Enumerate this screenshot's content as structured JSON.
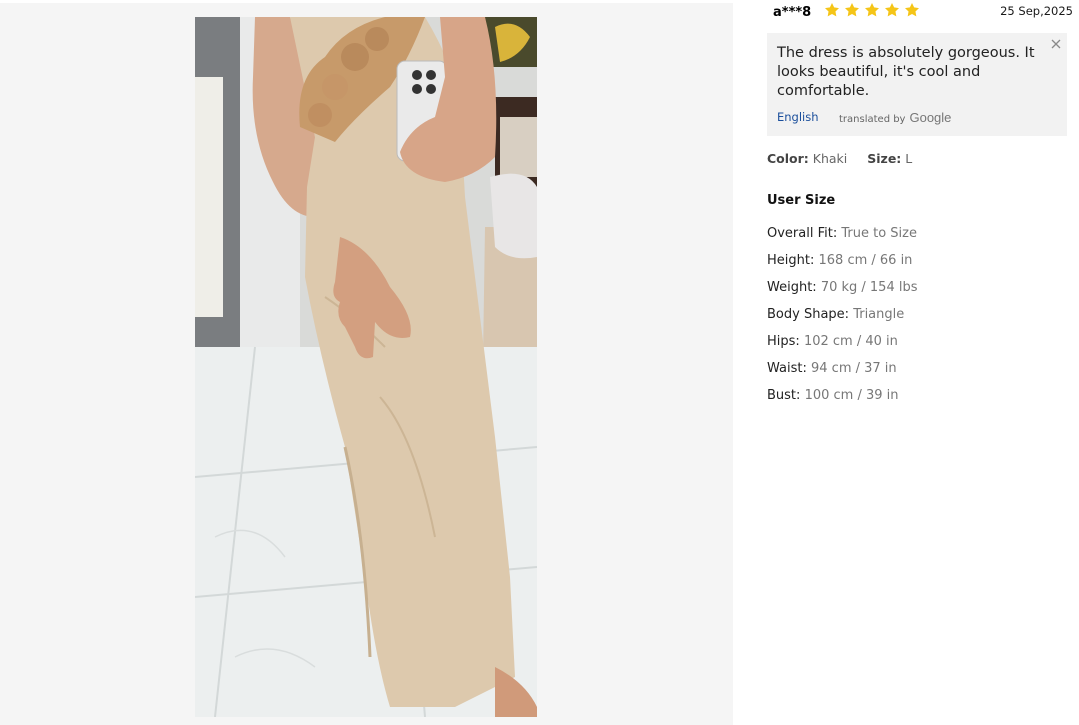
{
  "review": {
    "reviewer": "a***8",
    "rating": 5,
    "date": "25 Sep,2025",
    "text": "The dress is absolutely gorgeous. It looks beautiful, it's cool and comfortable.",
    "language_link": "English",
    "translated_by": "translated by",
    "translator_brand": "Google",
    "star_color": "#f5c518"
  },
  "sku": {
    "color_label": "Color:",
    "color_value": "Khaki",
    "size_label": "Size:",
    "size_value": "L"
  },
  "user_size": {
    "title": "User Size",
    "rows": [
      {
        "label": "Overall Fit:",
        "value": "True to Size"
      },
      {
        "label": "Height:",
        "value": "168 cm / 66 in"
      },
      {
        "label": "Weight:",
        "value": "70 kg / 154 lbs"
      },
      {
        "label": "Body Shape:",
        "value": "Triangle"
      },
      {
        "label": "Hips:",
        "value": "102 cm / 40 in"
      },
      {
        "label": "Waist:",
        "value": "94 cm / 37 in"
      },
      {
        "label": "Bust:",
        "value": "100 cm / 39 in"
      }
    ]
  }
}
